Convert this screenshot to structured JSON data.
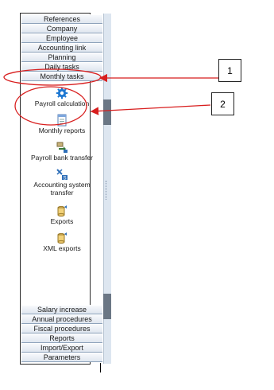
{
  "top_nav": [
    "References",
    "Company",
    "Employee",
    "Accounting link",
    "Planning",
    "Daily tasks",
    "Monthly tasks"
  ],
  "tasks": [
    {
      "label_lines": [
        "Payroll calculation"
      ],
      "icon": "gear-icon"
    },
    {
      "label_lines": [
        "Monthly reports"
      ],
      "icon": "report-icon"
    },
    {
      "label_lines": [
        "Payroll bank transfer"
      ],
      "icon": "bank-transfer-icon"
    },
    {
      "label_lines": [
        "Accounting system",
        "transfer"
      ],
      "icon": "accounting-transfer-icon"
    },
    {
      "label_lines": [
        "Exports"
      ],
      "icon": "export-icon"
    },
    {
      "label_lines": [
        "XML exports"
      ],
      "icon": "xml-export-icon"
    }
  ],
  "bottom_nav": [
    "Salary increase",
    "Annual procedures",
    "Fiscal procedures",
    "Reports",
    "Import/Export",
    "Parameters"
  ],
  "callouts": {
    "first": "1",
    "second": "2"
  },
  "colors": {
    "highlight": "#d81e1e",
    "nav_border": "#8ea3bb",
    "accent_blue": "#1e78d2"
  }
}
